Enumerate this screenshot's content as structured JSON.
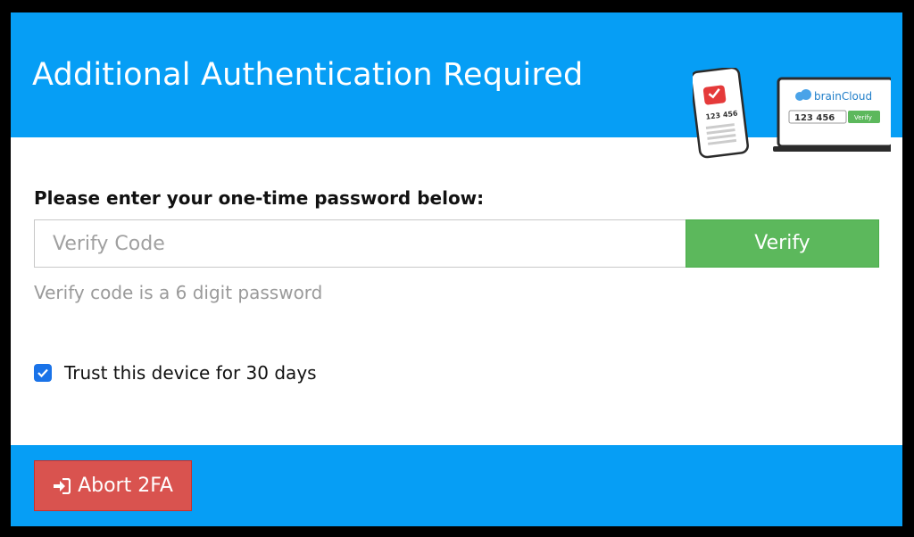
{
  "header": {
    "title": "Additional Authentication Required",
    "illustration": {
      "phone_code": "123 456",
      "laptop_brand": "brainCloud",
      "laptop_code": "123 456",
      "laptop_verify_label": "Verify"
    }
  },
  "form": {
    "prompt": "Please enter your one-time password below:",
    "code_placeholder": "Verify Code",
    "code_value": "",
    "verify_label": "Verify",
    "hint": "Verify code is a 6 digit password",
    "trust_label": "Trust this device for 30 days",
    "trust_checked": true
  },
  "footer": {
    "abort_label": "Abort 2FA",
    "abort_icon": "sign-in-icon"
  },
  "colors": {
    "header_bg": "#069ef5",
    "verify_green": "#5cb85c",
    "abort_red": "#d9534f",
    "checkbox_blue": "#1a73e8"
  }
}
